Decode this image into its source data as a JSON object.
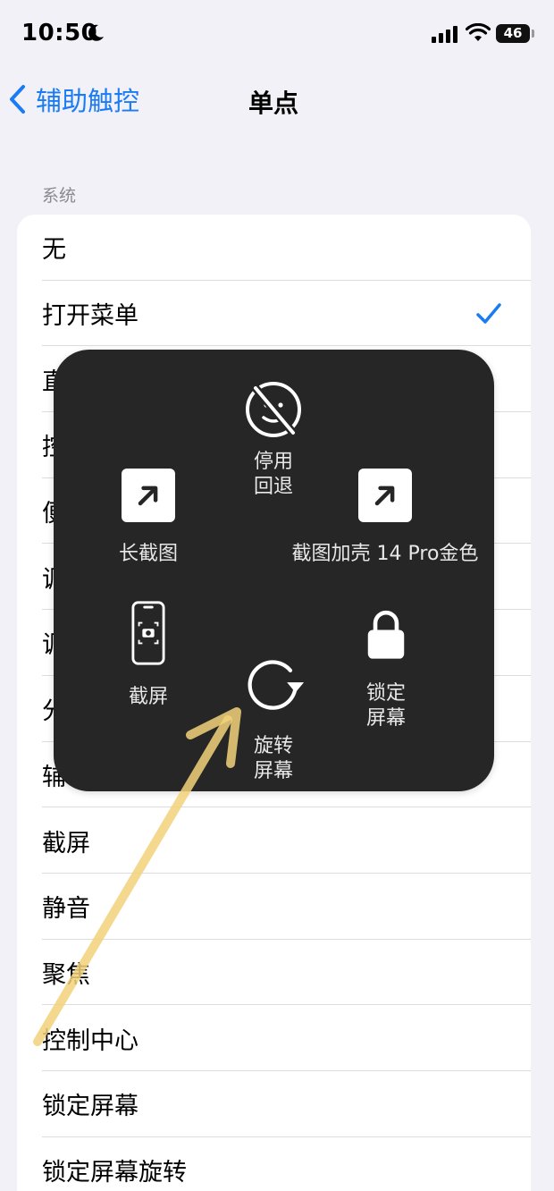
{
  "status_bar": {
    "time": "10:50",
    "battery": "46"
  },
  "nav": {
    "back_label": "辅助触控",
    "title": "单点"
  },
  "section": {
    "header": "系统",
    "rows": [
      {
        "label": "无"
      },
      {
        "label": "打开菜单",
        "checked": true
      },
      {
        "label": "直"
      },
      {
        "label": "控"
      },
      {
        "label": "便"
      },
      {
        "label": "调"
      },
      {
        "label": "调"
      },
      {
        "label": "分"
      },
      {
        "label": "辅"
      },
      {
        "label": "截屏"
      },
      {
        "label": "静音"
      },
      {
        "label": "聚焦"
      },
      {
        "label": "控制中心"
      },
      {
        "label": "锁定屏幕"
      },
      {
        "label": "锁定屏幕旋转"
      }
    ]
  },
  "menu": {
    "disable_back": {
      "line1": "停用",
      "line2": "回退",
      "icon": "no-face-icon"
    },
    "long_screenshot": {
      "label": "长截图",
      "icon": "arrow-up-right-icon"
    },
    "screenshot_case": {
      "label": "截图加壳 14 Pro金色",
      "icon": "arrow-up-right-icon"
    },
    "screenshot": {
      "label": "截屏",
      "icon": "phone-screenshot-icon"
    },
    "lock_screen": {
      "line1": "锁定",
      "line2": "屏幕",
      "icon": "lock-icon"
    },
    "rotate_screen": {
      "line1": "旋转",
      "line2": "屏幕",
      "icon": "rotate-icon"
    }
  },
  "colors": {
    "accent": "#1a7cf5",
    "menu_bg": "#262626",
    "arrow": "#f2d27a"
  }
}
